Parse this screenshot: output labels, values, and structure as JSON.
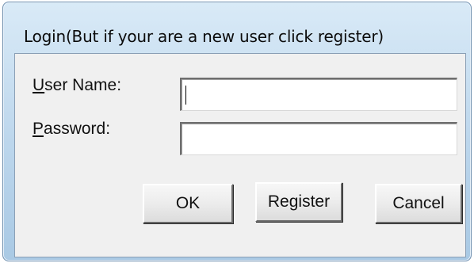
{
  "dialog": {
    "title": "Login(But if your are a new  user click register)"
  },
  "form": {
    "username_label_access": "U",
    "username_label_rest": "ser Name:",
    "username_value": "",
    "password_label_access": "P",
    "password_label_rest": "assword:",
    "password_value": ""
  },
  "buttons": {
    "ok_label": "OK",
    "register_label": "Register",
    "cancel_label": "Cancel"
  }
}
